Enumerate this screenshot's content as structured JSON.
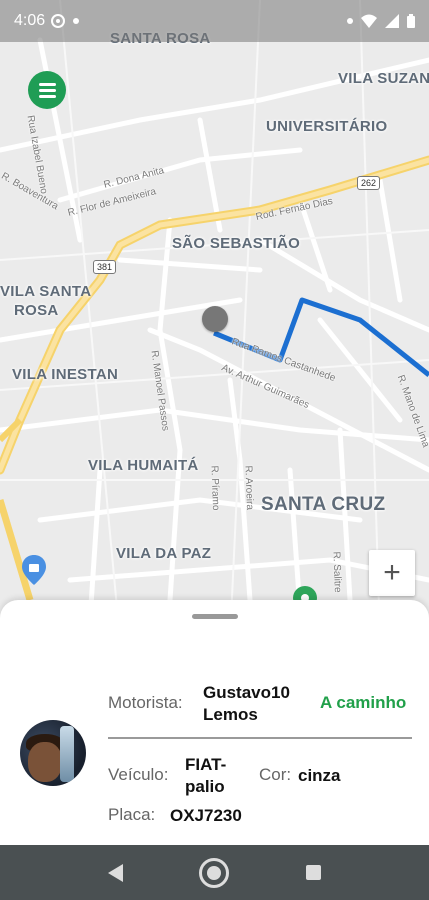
{
  "status_bar": {
    "time": "4:06"
  },
  "map": {
    "neighborhoods": [
      {
        "id": "santa-rosa",
        "text": "SANTA ROSA"
      },
      {
        "id": "vila-suzana",
        "text": "VILA SUZAN"
      },
      {
        "id": "universitario",
        "text": "UNIVERSITÁRIO"
      },
      {
        "id": "sao-sebastiao",
        "text": "SÃO SEBASTIÃO"
      },
      {
        "id": "vila-santa",
        "text": "VILA SANTA"
      },
      {
        "id": "rosa",
        "text": "ROSA"
      },
      {
        "id": "vila-inestan",
        "text": "VILA INESTAN"
      },
      {
        "id": "vila-humaita",
        "text": "VILA HUMAITÁ"
      },
      {
        "id": "santa-cruz",
        "text": "SANTA CRUZ"
      },
      {
        "id": "vila-da-paz",
        "text": "VILA DA PAZ"
      }
    ],
    "streets": [
      {
        "id": "dona-anita",
        "text": "R. Dona Anita"
      },
      {
        "id": "flor-de-ameixeira",
        "text": "R. Flor de Ameixeira"
      },
      {
        "id": "fernao-dias",
        "text": "Rod. Fernão Dias"
      },
      {
        "id": "izabel-bueno",
        "text": "Rua Izabel Bueno"
      },
      {
        "id": "boaventura",
        "text": "R. Boaventura"
      },
      {
        "id": "manoel-passos",
        "text": "R. Manoel Passos"
      },
      {
        "id": "arthur-guimaraes",
        "text": "Av. Arthur Guimarães"
      },
      {
        "id": "castanhede",
        "text": "Rua Ramos Castanhede"
      },
      {
        "id": "piramo",
        "text": "R. Píramo"
      },
      {
        "id": "aroeira",
        "text": "R. Aroeira"
      },
      {
        "id": "salitre",
        "text": "R. Salitre"
      },
      {
        "id": "mano-de-lima",
        "text": "R. Mano de Lima"
      }
    ],
    "shields": [
      {
        "id": "262",
        "text": "262"
      },
      {
        "id": "381",
        "text": "381"
      }
    ],
    "zoom_in": "+"
  },
  "driver": {
    "motorista_label": "Motorista:",
    "name_line1": "Gustavo10",
    "name_line2": "Lemos",
    "status": "A caminho",
    "veiculo_label": "Veículo:",
    "vehicle_line1": "FIAT-",
    "vehicle_line2": "palio",
    "cor_label": "Cor:",
    "color": "cinza",
    "placa_label": "Placa:",
    "plate": "OXJ7230"
  },
  "colors": {
    "accent": "#1f9d55",
    "status": "#21a04a",
    "route": "#1c6fd1"
  }
}
